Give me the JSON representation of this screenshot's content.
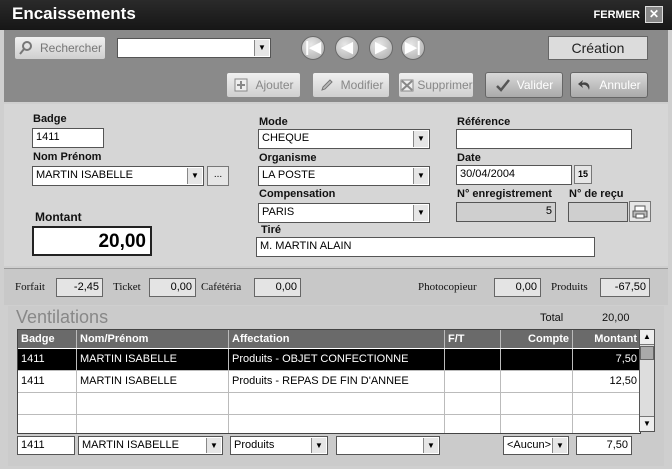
{
  "window": {
    "title": "Encaissements",
    "close_label": "FERMER",
    "close_glyph": "✕"
  },
  "toolbar": {
    "search_label": "Rechercher",
    "search_value": "",
    "nav": [
      "|◀",
      "◀",
      "▶",
      "▶|"
    ],
    "mode_label": "Création",
    "add_label": "Ajouter",
    "edit_label": "Modifier",
    "delete_label": "Supprimer",
    "validate_label": "Valider",
    "cancel_label": "Annuler"
  },
  "form": {
    "badge_label": "Badge",
    "badge_value": "1411",
    "name_label": "Nom Prénom",
    "name_value": "MARTIN ISABELLE",
    "name_more": "...",
    "amount_label": "Montant",
    "amount_value": "20,00",
    "mode_label": "Mode",
    "mode_value": "CHEQUE",
    "org_label": "Organisme",
    "org_value": "LA POSTE",
    "comp_label": "Compensation",
    "comp_value": "PARIS",
    "tire_label": "Tiré",
    "tire_value": "M. MARTIN ALAIN",
    "ref_label": "Référence",
    "ref_value": "",
    "date_label": "Date",
    "date_value": "30/04/2004",
    "date_btn": "15",
    "reg_label": "N° enregistrement",
    "reg_value": "5",
    "receipt_label": "N° de reçu",
    "receipt_value": ""
  },
  "summary": {
    "forfait_label": "Forfait",
    "forfait_value": "-2,45",
    "ticket_label": "Ticket",
    "ticket_value": "0,00",
    "cafeteria_label": "Cafétéria",
    "cafeteria_value": "0,00",
    "photo_label": "Photocopieur",
    "photo_value": "0,00",
    "produits_label": "Produits",
    "produits_value": "-67,50"
  },
  "ventilations": {
    "title": "Ventilations",
    "total_label": "Total",
    "total_value": "20,00",
    "columns": [
      "Badge",
      "Nom/Prénom",
      "Affectation",
      "F/T",
      "Compte",
      "Montant"
    ],
    "rows": [
      {
        "badge": "1411",
        "name": "MARTIN ISABELLE",
        "affect": "Produits - OBJET CONFECTIONNE",
        "ft": "",
        "compte": "",
        "montant": "7,50"
      },
      {
        "badge": "1411",
        "name": "MARTIN ISABELLE",
        "affect": "Produits - REPAS DE FIN D'ANNEE",
        "ft": "",
        "compte": "",
        "montant": "12,50"
      }
    ],
    "edit_row": {
      "badge": "1411",
      "name": "MARTIN ISABELLE",
      "affect": "Produits",
      "sub": "",
      "compte": "<Aucun>",
      "montant": "7,50"
    }
  }
}
